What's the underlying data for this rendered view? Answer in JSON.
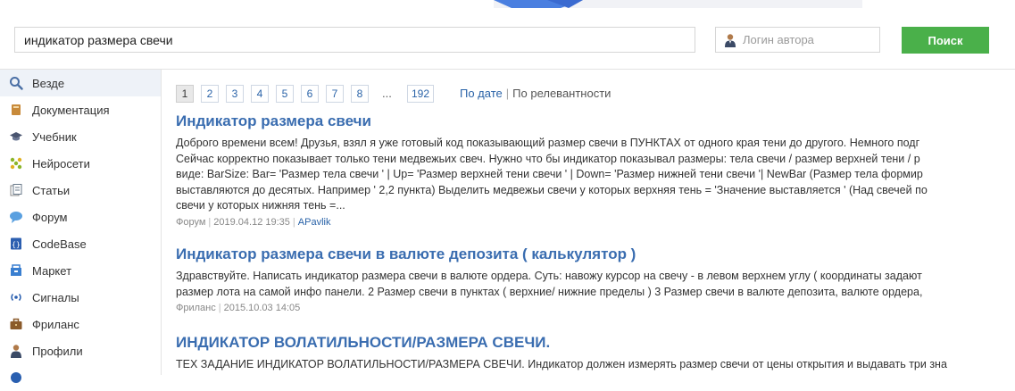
{
  "search": {
    "query": "индикатор размера свечи",
    "author_placeholder": "Логин автора",
    "button_label": "Поиск"
  },
  "sidebar": {
    "items": [
      {
        "label": "Везде",
        "icon": "magnifier-icon",
        "active": true
      },
      {
        "label": "Документация",
        "icon": "book-icon"
      },
      {
        "label": "Учебник",
        "icon": "graduation-cap-icon"
      },
      {
        "label": "Нейросети",
        "icon": "neural-net-icon"
      },
      {
        "label": "Статьи",
        "icon": "articles-icon"
      },
      {
        "label": "Форум",
        "icon": "speech-bubble-icon"
      },
      {
        "label": "CodeBase",
        "icon": "codebase-icon"
      },
      {
        "label": "Маркет",
        "icon": "market-icon"
      },
      {
        "label": "Сигналы",
        "icon": "signal-icon"
      },
      {
        "label": "Фриланс",
        "icon": "briefcase-icon"
      },
      {
        "label": "Профили",
        "icon": "user-icon"
      }
    ]
  },
  "pagination": {
    "pages": [
      "1",
      "2",
      "3",
      "4",
      "5",
      "6",
      "7",
      "8"
    ],
    "ellipsis": "...",
    "last": "192",
    "current": "1"
  },
  "sort": {
    "by_date": "По дате",
    "separator": "|",
    "by_relevance": "По релевантности"
  },
  "results": [
    {
      "title": "Индикатор размера свечи",
      "snippet": [
        "Доброго времени всем! Друзья, взял я уже готовый код показывающий размер свечи в ПУНКТАХ от одного края тени до другого. Немного подг",
        "Сейчас корректно показывает только тени медвежьих свеч. Нужно что бы индикатор показывал размеры: тела свечи / размер верхней тени / р",
        "виде: BarSize: Bar= 'Размер тела свечи ' | Up= 'Размер верхней тени свечи ' | Down= 'Размер нижней тени свечи '| NewBar (Размер тела формир",
        "выставляются до десятых. Например ' 2,2 пункта) Выделить медвежьи свечи у которых верхняя тень = 'Значение выставляется ' (Над свечей по",
        "свечи у которых нижняя тень =..."
      ],
      "section": "Форум",
      "date": "2019.04.12 19:35",
      "author": "APavlik"
    },
    {
      "title": "Индикатор размера свечи в валюте депозита ( калькулятор )",
      "snippet": [
        "Здравствуйте. Написать индикатор размера свечи в валюте ордера. Суть: навожу курсор на свечу - в левом верхнем углу ( координаты задают",
        "размер лота на самой инфо панели. 2 Размер свечи в пунктах ( верхние/ нижние пределы ) 3 Размер свечи в валюте депозита, валюте ордера,"
      ],
      "section": "Фриланс",
      "date": "2015.10.03 14:05"
    },
    {
      "title": "ИНДИКАТОР ВОЛАТИЛЬНОСТИ/РАЗМЕРА СВЕЧИ.",
      "snippet": [
        "ТЕХ ЗАДАНИЕ ИНДИКАТОР ВОЛАТИЛЬНОСТИ/РАЗМЕРА СВЕЧИ. Индикатор должен измерять размер свечи от цены открытия и выдавать три зна"
      ]
    }
  ],
  "meta_separator": "|",
  "colors": {
    "accent_link": "#3a6db0",
    "search_button": "#4ab04a",
    "active_sidebar": "#eef2f8"
  }
}
